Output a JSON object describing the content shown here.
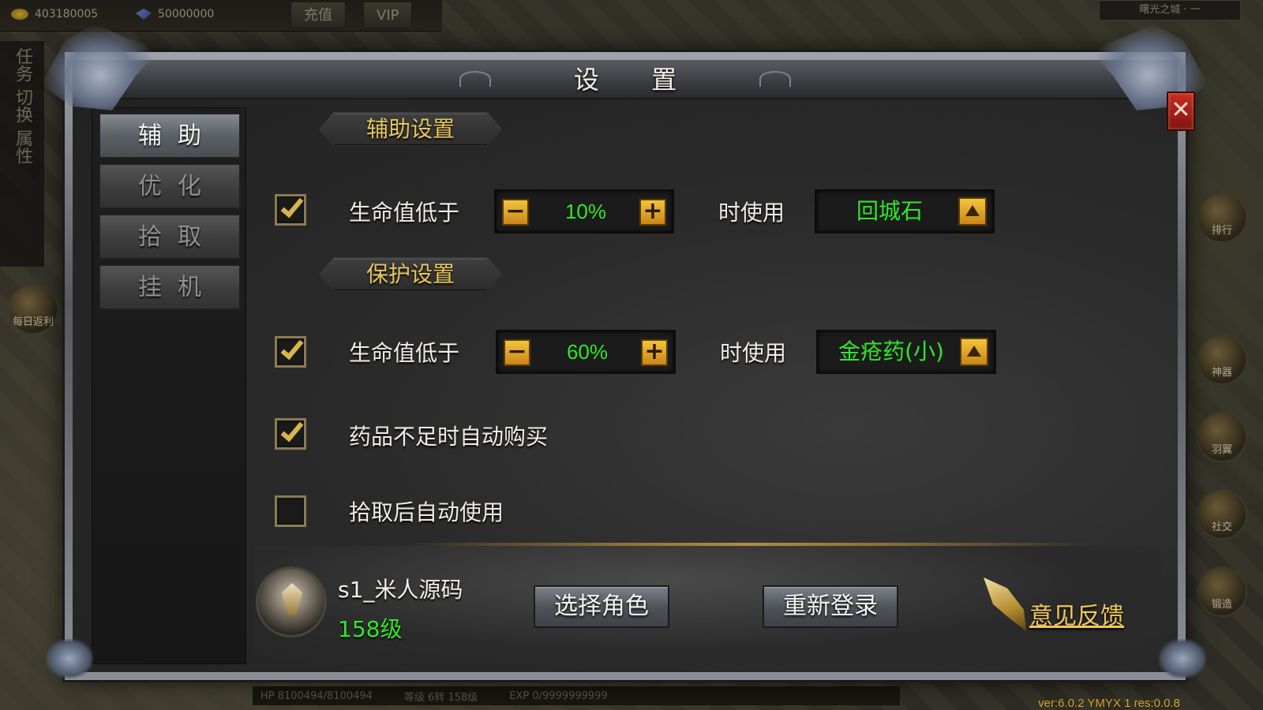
{
  "hud": {
    "gold": "403180005",
    "diamonds": "50000000",
    "recharge_label": "充值",
    "vip_label": "VIP",
    "map_name": "曙光之城 · 一",
    "left_menu": [
      "任务",
      "切换",
      "属性"
    ],
    "daily_rebate": "每日返利",
    "right_menu": [
      "排行",
      "神器",
      "羽翼",
      "社交",
      "锻造"
    ],
    "status": {
      "hp": "HP 8100494/8100494",
      "level": "等级 6转 158级",
      "exp": "EXP 0/9999999999"
    },
    "version": "ver:6.0.2 YMYX 1 res:0.0.8"
  },
  "dialog": {
    "title": "设 置",
    "close_label": "✕",
    "tabs": [
      {
        "label": "辅助",
        "active": true
      },
      {
        "label": "优化",
        "active": false
      },
      {
        "label": "拾取",
        "active": false
      },
      {
        "label": "挂机",
        "active": false
      }
    ],
    "assist_section": {
      "header": "辅助设置",
      "checked": true,
      "label": "生命值低于",
      "minus": "−",
      "value": "10%",
      "plus": "+",
      "use_label": "时使用",
      "item": "回城石"
    },
    "protect_section": {
      "header": "保护设置",
      "checked": true,
      "label": "生命值低于",
      "minus": "−",
      "value": "60%",
      "plus": "+",
      "use_label": "时使用",
      "item": "金疮药(小)"
    },
    "auto_buy": {
      "checked": true,
      "label": "药品不足时自动购买"
    },
    "auto_use": {
      "checked": false,
      "label": "拾取后自动使用"
    },
    "player": {
      "name": "s1_米人源码",
      "level": "158级"
    },
    "select_role_label": "选择角色",
    "relogin_label": "重新登录",
    "feedback_label": "意见反馈"
  },
  "colors": {
    "accent_gold": "#e7c55c",
    "value_green": "#31e62a",
    "close_red": "#c82e22"
  }
}
